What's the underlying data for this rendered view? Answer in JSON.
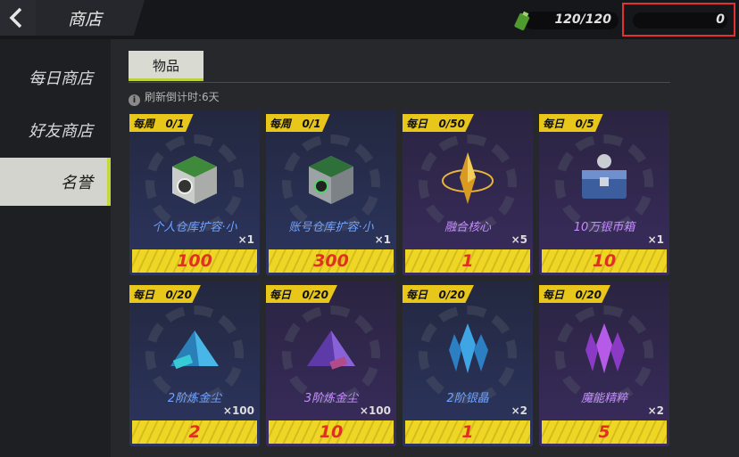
{
  "header": {
    "title": "商店"
  },
  "resources": {
    "energy": "120/120",
    "currency": "0"
  },
  "sidebar": {
    "items": [
      {
        "label": "每日商店"
      },
      {
        "label": "好友商店"
      },
      {
        "label": "名誉"
      }
    ]
  },
  "tab": {
    "label": "物品"
  },
  "refresh_text": "刷新倒计时:6天",
  "info_glyph": "i",
  "items": [
    {
      "tag": "每周   0/1",
      "name": "个人仓库扩容·小",
      "count": "×1",
      "price": "100",
      "name_color": "#6fa3ff",
      "icon": "green-crate-icon"
    },
    {
      "tag": "每周   0/1",
      "name": "账号仓库扩容·小",
      "count": "×1",
      "price": "300",
      "name_color": "#6fa3ff",
      "icon": "steel-crate-icon"
    },
    {
      "tag": "每日   0/50",
      "name": "融合核心",
      "count": "×5",
      "price": "1",
      "name_color": "#c58cff",
      "icon": "fusion-core-icon"
    },
    {
      "tag": "每日   0/5",
      "name": "10万银币箱",
      "count": "×1",
      "price": "10",
      "name_color": "#c58cff",
      "icon": "silver-chest-icon"
    },
    {
      "tag": "每日   0/20",
      "name": "2阶炼金尘",
      "count": "×100",
      "price": "2",
      "name_color": "#6fa3ff",
      "icon": "blue-dust-icon"
    },
    {
      "tag": "每日   0/20",
      "name": "3阶炼金尘",
      "count": "×100",
      "price": "10",
      "name_color": "#c58cff",
      "icon": "purple-dust-icon"
    },
    {
      "tag": "每日   0/20",
      "name": "2阶银晶",
      "count": "×2",
      "price": "1",
      "name_color": "#6fa3ff",
      "icon": "blue-crystal-icon"
    },
    {
      "tag": "每日   0/20",
      "name": "魔能精粹",
      "count": "×2",
      "price": "5",
      "name_color": "#c58cff",
      "icon": "magic-essence-icon"
    }
  ]
}
